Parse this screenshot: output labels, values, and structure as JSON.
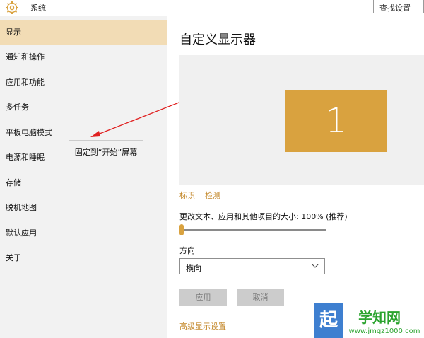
{
  "header": {
    "app_title": "系统",
    "search_placeholder": "查找设置",
    "icon": "gear-icon"
  },
  "sidebar": {
    "items": [
      {
        "label": "显示",
        "active": true
      },
      {
        "label": "通知和操作"
      },
      {
        "label": "应用和功能"
      },
      {
        "label": "多任务"
      },
      {
        "label": "平板电脑模式"
      },
      {
        "label": "电源和睡眠"
      },
      {
        "label": "存储"
      },
      {
        "label": "脱机地图"
      },
      {
        "label": "默认应用"
      },
      {
        "label": "关于"
      }
    ]
  },
  "tooltip": {
    "label": "固定到“开始”屏幕"
  },
  "main": {
    "title": "自定义显示器",
    "monitor_number": "1",
    "identify_link": "标识",
    "detect_link": "检测",
    "scale_label": "更改文本、应用和其他项目的大小: 100% (推荐)",
    "scale_slider_value": 0,
    "orientation_label": "方向",
    "orientation_value": "横向",
    "apply_button": "应用",
    "cancel_button": "取消",
    "advanced_link": "高级显示设置"
  },
  "watermark": {
    "text": "学知网",
    "url_text": "www.jmqz1000.com"
  },
  "colors": {
    "accent": "#d9a23f",
    "active_nav": "#f2dcb5",
    "sidebar_bg": "#f2f2f2",
    "link": "#c4892c"
  }
}
